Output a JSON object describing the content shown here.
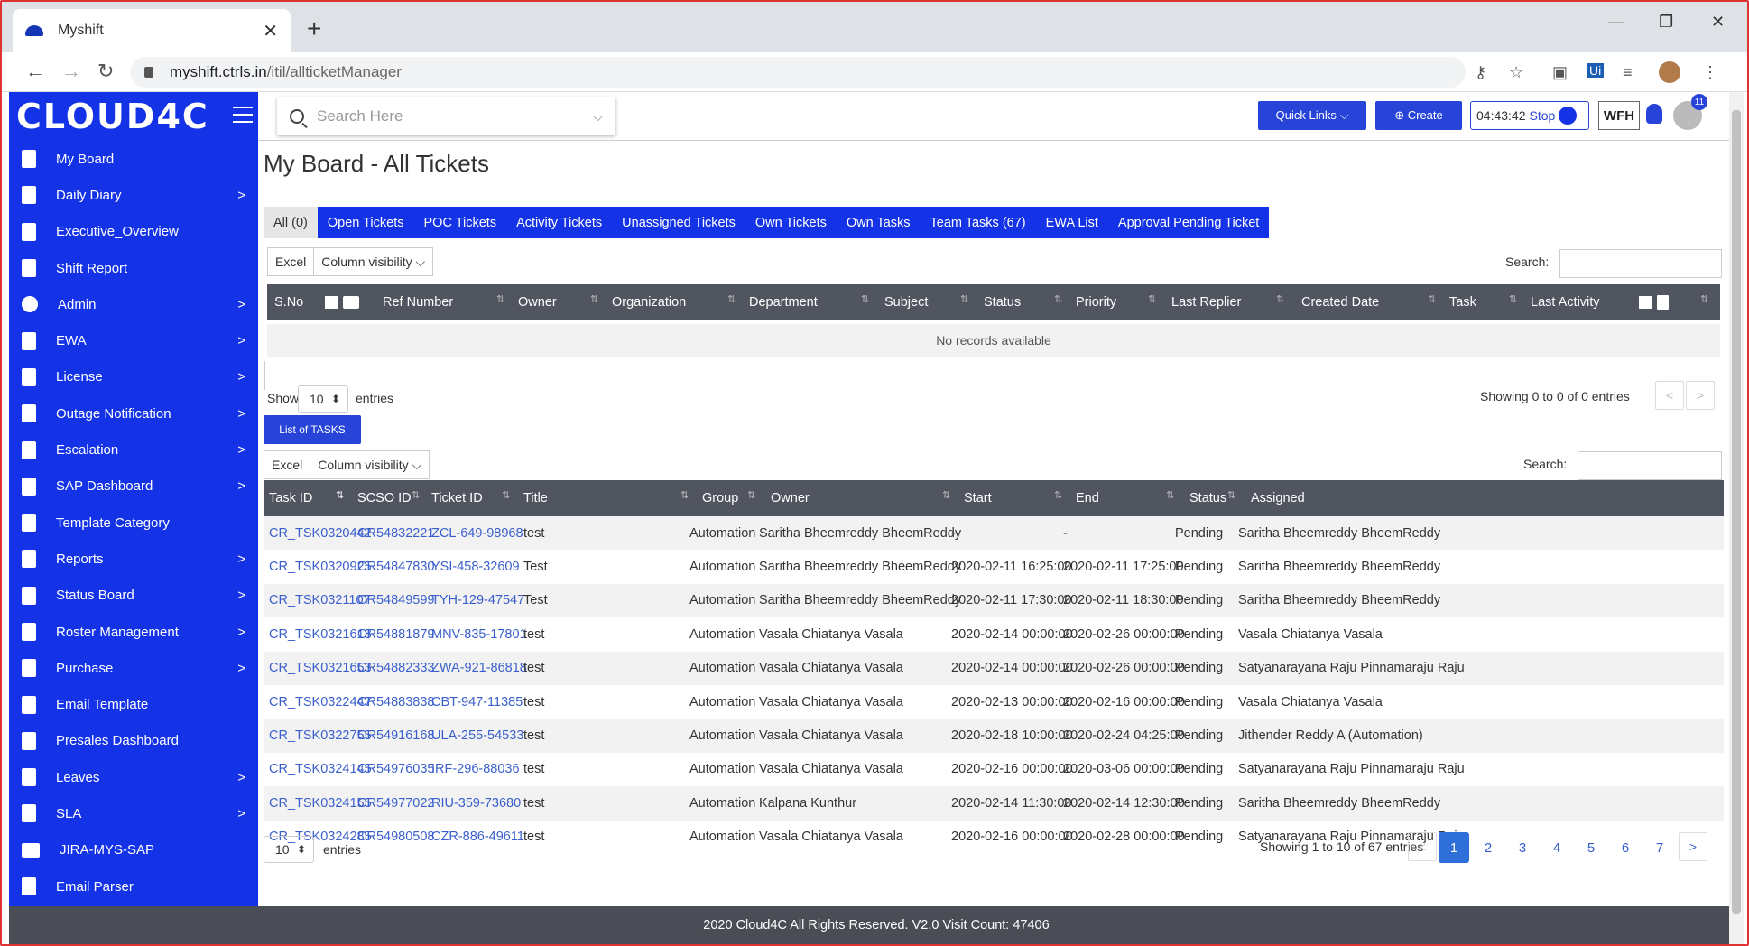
{
  "browser": {
    "tab_title": "Myshift",
    "tab_close": "✕",
    "new_tab": "+",
    "url_host": "myshift.ctrls.in",
    "url_path": "/itil/allticketManager",
    "win_min": "—",
    "win_max": "❐",
    "win_close": "✕"
  },
  "header": {
    "brand": "CLOUD4C",
    "search_placeholder": "Search Here",
    "quick_links": "Quick Links ⌵",
    "create": "⊕  Create",
    "timer": "04:43:42",
    "stop": "Stop",
    "wfh": "WFH",
    "notif_count": "11"
  },
  "sidebar": {
    "items": [
      {
        "label": "My Board",
        "arrow": ""
      },
      {
        "label": "Daily Diary",
        "arrow": ">"
      },
      {
        "label": "Executive_Overview",
        "arrow": ""
      },
      {
        "label": "Shift Report",
        "arrow": ""
      },
      {
        "label": "Admin",
        "arrow": ">"
      },
      {
        "label": "EWA",
        "arrow": ">"
      },
      {
        "label": "License",
        "arrow": ">"
      },
      {
        "label": "Outage Notification",
        "arrow": ">"
      },
      {
        "label": "Escalation",
        "arrow": ">"
      },
      {
        "label": "SAP Dashboard",
        "arrow": ">"
      },
      {
        "label": "Template Category",
        "arrow": ""
      },
      {
        "label": "Reports",
        "arrow": ">"
      },
      {
        "label": "Status Board",
        "arrow": ">"
      },
      {
        "label": "Roster Management",
        "arrow": ">"
      },
      {
        "label": "Purchase",
        "arrow": ">"
      },
      {
        "label": "Email Template",
        "arrow": ""
      },
      {
        "label": "Presales Dashboard",
        "arrow": ""
      },
      {
        "label": "Leaves",
        "arrow": ">"
      },
      {
        "label": "SLA",
        "arrow": ">"
      },
      {
        "label": "JIRA-MYS-SAP",
        "arrow": ""
      },
      {
        "label": "Email Parser",
        "arrow": ""
      }
    ]
  },
  "main": {
    "title": "My Board - All Tickets",
    "tabs": [
      "All (0)",
      "Open Tickets",
      "POC Tickets",
      "Activity Tickets",
      "Unassigned Tickets",
      "Own Tickets",
      "Own Tasks",
      "Team Tasks (67)",
      "EWA List",
      "Approval Pending Ticket"
    ],
    "excel": "Excel",
    "column_visibility": "Column visibility ⌵",
    "search_label": "Search:",
    "tickets_columns": [
      "S.No",
      "Ref Number",
      "Owner",
      "Organization",
      "Department",
      "Subject",
      "Status",
      "Priority",
      "Last Replier",
      "Created Date",
      "Task",
      "Last Activity"
    ],
    "no_records": "No records available",
    "show": "Show",
    "page_size": "10",
    "entries": "entries",
    "tickets_info": "Showing 0 to 0 of 0 entries",
    "prev": "<",
    "next": ">",
    "list_tasks": "List of TASKS",
    "task_columns": [
      "Task ID",
      "SCSO ID",
      "Ticket ID",
      "Title",
      "Group",
      "Owner",
      "Start",
      "End",
      "Status",
      "Assigned"
    ],
    "tasks": [
      [
        "CR_TSK0320442",
        "CR54832221",
        "ZCL-649-98968",
        "test",
        "Automation",
        "Saritha Bheemreddy BheemReddy",
        "-",
        "-",
        "Pending",
        "Saritha Bheemreddy BheemReddy"
      ],
      [
        "CR_TSK0320925",
        "CR54847830",
        "YSI-458-32609",
        "Test",
        "Automation",
        "Saritha Bheemreddy BheemReddy",
        "2020-02-11 16:25:00",
        "2020-02-11 17:25:00",
        "Pending",
        "Saritha Bheemreddy BheemReddy"
      ],
      [
        "CR_TSK0321107",
        "CR54849599",
        "TYH-129-47547",
        "Test",
        "Automation",
        "Saritha Bheemreddy BheemReddy",
        "2020-02-11 17:30:00",
        "2020-02-11 18:30:00",
        "Pending",
        "Saritha Bheemreddy BheemReddy"
      ],
      [
        "CR_TSK0321618",
        "CR54881879",
        "MNV-835-17801",
        "test",
        "Automation",
        "Vasala Chiatanya Vasala",
        "2020-02-14 00:00:00",
        "2020-02-26 00:00:00",
        "Pending",
        "Vasala Chiatanya Vasala"
      ],
      [
        "CR_TSK0321653",
        "CR54882333",
        "ZWA-921-86818",
        "test",
        "Automation",
        "Vasala Chiatanya Vasala",
        "2020-02-14 00:00:00",
        "2020-02-26 00:00:00",
        "Pending",
        "Satyanarayana Raju Pinnamaraju Raju"
      ],
      [
        "CR_TSK0322447",
        "CR54883838",
        "CBT-947-11385",
        "test",
        "Automation",
        "Vasala Chiatanya Vasala",
        "2020-02-13 00:00:00",
        "2020-02-16 00:00:00",
        "Pending",
        "Vasala Chiatanya Vasala"
      ],
      [
        "CR_TSK0322755",
        "CR54916168",
        "ULA-255-54533",
        "test",
        "Automation",
        "Vasala Chiatanya Vasala",
        "2020-02-18 10:00:00",
        "2020-02-24 04:25:00",
        "Pending",
        "Jithender Reddy A (Automation)"
      ],
      [
        "CR_TSK0324145",
        "CR54976035",
        "IRF-296-88036",
        "test",
        "Automation",
        "Vasala Chiatanya Vasala",
        "2020-02-16 00:00:00",
        "2020-03-06 00:00:00",
        "Pending",
        "Satyanarayana Raju Pinnamaraju Raju"
      ],
      [
        "CR_TSK0324155",
        "CR54977022",
        "RIU-359-73680",
        "test",
        "Automation",
        "Kalpana Kunthur",
        "2020-02-14 11:30:00",
        "2020-02-14 12:30:00",
        "Pending",
        "Saritha Bheemreddy BheemReddy"
      ],
      [
        "CR_TSK0324285",
        "CR54980508",
        "CZR-886-49611",
        "test",
        "Automation",
        "Vasala Chiatanya Vasala",
        "2020-02-16 00:00:00",
        "2020-02-28 00:00:00",
        "Pending",
        "Satyanarayana Raju Pinnamaraju Raju"
      ]
    ],
    "tasks_info": "Showing 1 to 10 of 67 entries",
    "pages": [
      "1",
      "2",
      "3",
      "4",
      "5",
      "6",
      "7"
    ]
  },
  "footer": {
    "text": "2020 Cloud4C All Rights Reserved. V2.0 Visit Count: 47406"
  }
}
